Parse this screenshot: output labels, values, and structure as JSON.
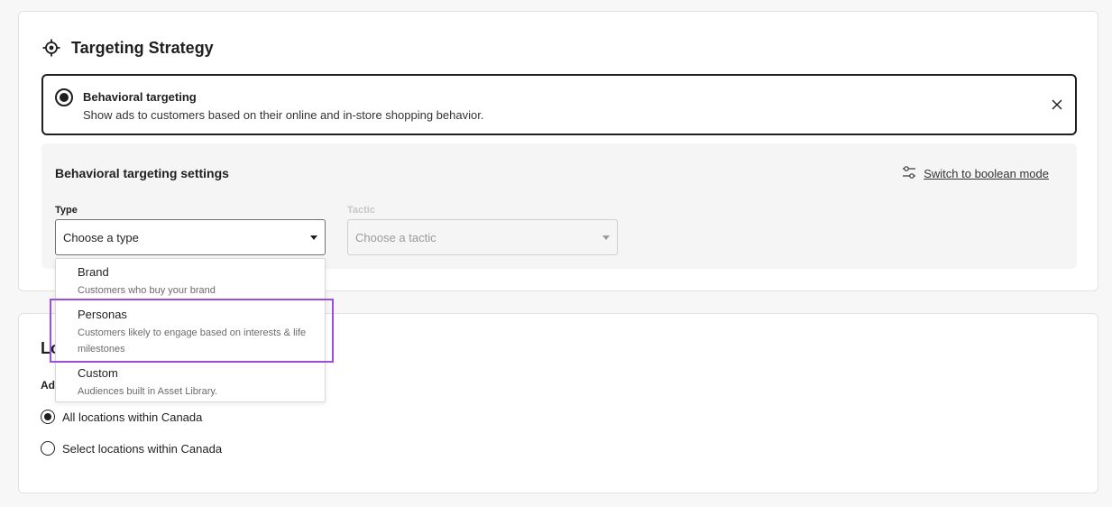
{
  "strategy": {
    "title": "Targeting Strategy",
    "option": {
      "title": "Behavioral targeting",
      "description": "Show ads to customers based on their online and in-store shopping behavior."
    },
    "settings": {
      "title": "Behavioral targeting settings",
      "boolean_link": "Switch to boolean mode",
      "type_label": "Type",
      "type_placeholder": "Choose a type",
      "tactic_label": "Tactic",
      "tactic_placeholder": "Choose a tactic"
    },
    "type_options": [
      {
        "name": "Brand",
        "description": "Customers who buy your brand"
      },
      {
        "name": "Personas",
        "description": "Customers likely to engage based on interests & life milestones"
      },
      {
        "name": "Custom",
        "description": "Audiences built in Asset Library."
      }
    ]
  },
  "location": {
    "title": "Lo",
    "subtitle": "Ad",
    "options": [
      {
        "label": "All locations within Canada",
        "checked": true
      },
      {
        "label": "Select locations within Canada",
        "checked": false
      }
    ]
  },
  "colors": {
    "highlight": "#9b4fdc",
    "text": "#1f1f1f"
  }
}
